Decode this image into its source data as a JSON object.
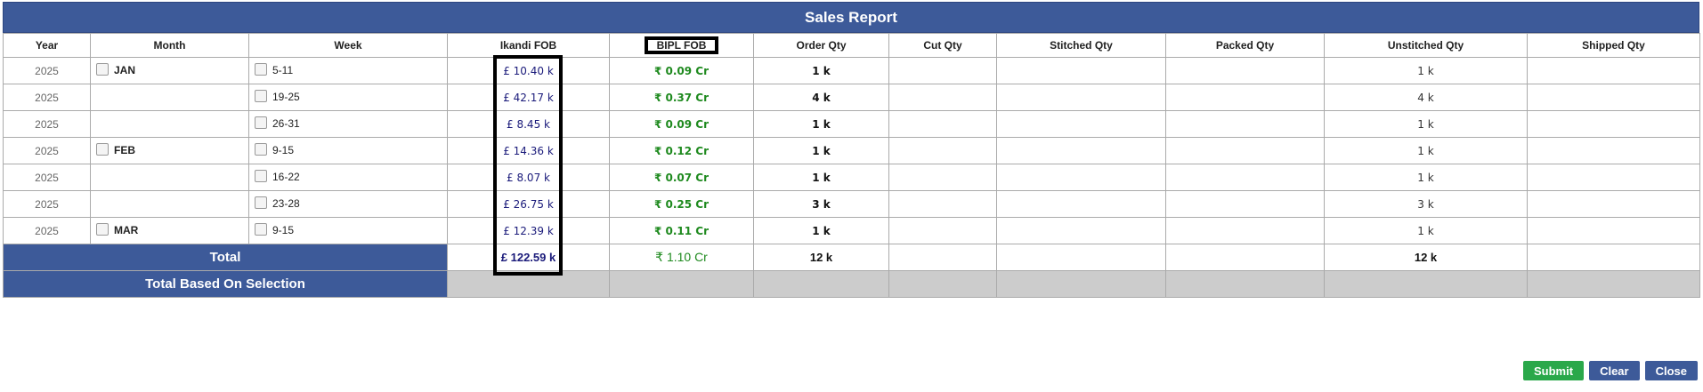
{
  "report": {
    "title": "Sales Report",
    "headers": [
      "Year",
      "Month",
      "Week",
      "Ikandi FOB",
      "BIPL FOB",
      "Order Qty",
      "Cut Qty",
      "Stitched Qty",
      "Packed Qty",
      "Unstitched Qty",
      "Shipped Qty"
    ],
    "rows": [
      {
        "year": "2025",
        "month": "JAN",
        "week": "5-11",
        "ikandi": "£ 10.40 k",
        "bipl": "₹ 0.09 Cr",
        "order": "1 k",
        "cut": "",
        "stitched": "",
        "packed": "",
        "unstitched": "1 k",
        "shipped": ""
      },
      {
        "year": "2025",
        "month": "",
        "week": "19-25",
        "ikandi": "£ 42.17 k",
        "bipl": "₹ 0.37 Cr",
        "order": "4 k",
        "cut": "",
        "stitched": "",
        "packed": "",
        "unstitched": "4 k",
        "shipped": ""
      },
      {
        "year": "2025",
        "month": "",
        "week": "26-31",
        "ikandi": "£ 8.45 k",
        "bipl": "₹ 0.09 Cr",
        "order": "1 k",
        "cut": "",
        "stitched": "",
        "packed": "",
        "unstitched": "1 k",
        "shipped": ""
      },
      {
        "year": "2025",
        "month": "FEB",
        "week": "9-15",
        "ikandi": "£ 14.36 k",
        "bipl": "₹ 0.12 Cr",
        "order": "1 k",
        "cut": "",
        "stitched": "",
        "packed": "",
        "unstitched": "1 k",
        "shipped": ""
      },
      {
        "year": "2025",
        "month": "",
        "week": "16-22",
        "ikandi": "£ 8.07 k",
        "bipl": "₹ 0.07 Cr",
        "order": "1 k",
        "cut": "",
        "stitched": "",
        "packed": "",
        "unstitched": "1 k",
        "shipped": ""
      },
      {
        "year": "2025",
        "month": "",
        "week": "23-28",
        "ikandi": "£ 26.75 k",
        "bipl": "₹ 0.25 Cr",
        "order": "3 k",
        "cut": "",
        "stitched": "",
        "packed": "",
        "unstitched": "3 k",
        "shipped": ""
      },
      {
        "year": "2025",
        "month": "MAR",
        "week": "9-15",
        "ikandi": "£ 12.39 k",
        "bipl": "₹ 0.11 Cr",
        "order": "1 k",
        "cut": "",
        "stitched": "",
        "packed": "",
        "unstitched": "1 k",
        "shipped": ""
      }
    ],
    "total": {
      "label": "Total",
      "ikandi": "£ 122.59 k",
      "bipl": "₹ 1.10 Cr",
      "order": "12 k",
      "unstitched": "12 k"
    },
    "selection": {
      "label": "Total Based On Selection"
    }
  },
  "buttons": {
    "submit": "Submit",
    "clear": "Clear",
    "close": "Close"
  },
  "colors": {
    "header_blue": "#3d5a99",
    "submit_green": "#2aa84a",
    "bipl_green": "#1f8a1f",
    "ikandi_navy": "#1a1a7a"
  }
}
